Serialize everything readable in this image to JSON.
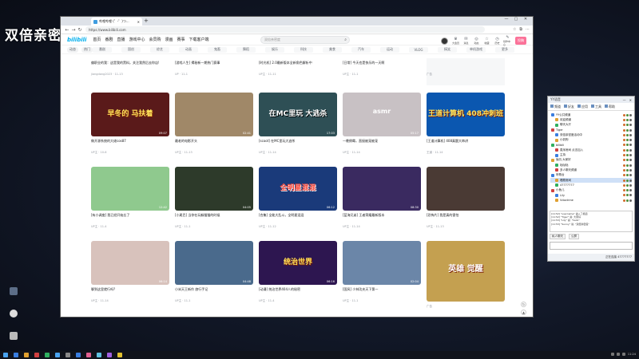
{
  "overlay": {
    "text": "双倍亲密度"
  },
  "browser": {
    "tab_title": "哔哩哔哩 (゜-゜)つ...",
    "url": "https://www.bilibili.com",
    "win_controls": [
      "—",
      "▢",
      "✕"
    ]
  },
  "bili": {
    "logo": "bilibili",
    "nav": [
      "首页",
      "番剧",
      "直播",
      "游戏中心",
      "会员购",
      "漫画",
      "赛事",
      "下载客户端"
    ],
    "search_placeholder": "双倍亲密度",
    "right": [
      "大会员",
      "消息",
      "动态",
      "收藏",
      "历史",
      "创作中心"
    ],
    "upload": "投稿",
    "cat_left": [
      "动态",
      "热门"
    ],
    "categories": [
      "番剧",
      "国创",
      "综艺",
      "动画",
      "鬼畜",
      "舞蹈",
      "娱乐",
      "科技",
      "美食",
      "汽车",
      "运动",
      "VLOG",
      "搞笑",
      "单机游戏",
      "更多"
    ]
  },
  "top_row": [
    {
      "title": "偏职业的我：这是我的黑料，关注我然后去你店!",
      "meta": "jiangdong2023 · 11-13"
    },
    {
      "title": "[游戏人生] 揭秘新一期热门赛事",
      "meta": "UP · 11-1"
    },
    {
      "title": "[时光机] 2.0最新版本全新角色解析中",
      "meta": "UP主 · 11-11"
    },
    {
      "title": "[日常] 今天也是快乐的一天啊",
      "meta": "UP主 · 11-1"
    },
    {
      "title": "",
      "meta": "广告"
    }
  ],
  "rows": [
    [
      {
        "title": "做开源系统的大佬cos87",
        "meta": "UP主 · 10-6",
        "dur": "09:07",
        "stat": "",
        "thumb": "#5a1a1a",
        "tt": "早冬的 马扶着"
      },
      {
        "title": "最老的电影开头",
        "meta": "UP主 · 11-13",
        "dur": "02:41",
        "stat": "",
        "thumb": "#a08868",
        "tt": ""
      },
      {
        "title": "[scoot] 在MC里玩大逃杀",
        "meta": "UP主 · 11-14",
        "dur": "17:03",
        "stat": "",
        "thumb": "#2e4f55",
        "tt": "在MC里玩 大逃杀"
      },
      {
        "title": "一晚倒霉，直接被宠被宠",
        "meta": "UP主 · 11-14",
        "dur": "05:17",
        "stat": "",
        "thumb": "#c8c1c4",
        "tt": "asmr"
      },
      {
        "title": "[王道计算机] 408真题大串讲",
        "meta": "王道 · 11-14",
        "dur": "",
        "stat": "",
        "thumb": "#0b57b0",
        "tt": "王道计算机 408冲刺班"
      }
    ],
    [
      {
        "title": "[有小调度] 我已经开始忘了",
        "meta": "UP主 · 11-4",
        "dur": "12:42",
        "stat": "",
        "thumb": "#8fc98e",
        "tt": ""
      },
      {
        "title": "[小尾巴] 当你在玩躲猫猫的时候",
        "meta": "UP主 · 11-1",
        "dur": "04:05",
        "stat": "",
        "thumb": "#2d3a2a",
        "tt": ""
      },
      {
        "title": "[合集] 全能大乱斗，全明星混混",
        "meta": "UP主 · 11-12",
        "dur": "06:12",
        "stat": "",
        "thumb": "#1a3a7a",
        "tt": "全明星混混"
      },
      {
        "title": "[蓝海兄弟] 王者荣耀最新版本",
        "meta": "UP主 · 11-14",
        "dur": "08:30",
        "stat": "",
        "thumb": "#3a2a60",
        "tt": ""
      },
      {
        "title": "[恐怖片] 我是真的害怕",
        "meta": "UP主 · 11-13",
        "dur": "",
        "stat": "",
        "thumb": "#4a3a34",
        "tt": ""
      }
    ],
    [
      {
        "title": "聊到这里就行吗?",
        "meta": "UP主 · 11-14",
        "dur": "06:14",
        "stat": "",
        "thumb": "#d8c2bc",
        "tt": ""
      },
      {
        "title": "小米天王新作 旅行手记",
        "meta": "UP主 · 11-1",
        "dur": "04:48",
        "stat": "",
        "thumb": "#4a6a8c",
        "tt": ""
      },
      {
        "title": "[动漫] 统治世界404人的秘密",
        "meta": "UP主 · 11-4",
        "dur": "06:16",
        "stat": "",
        "thumb": "#2d1650",
        "tt": "统治世界"
      },
      {
        "title": "[国风] 少林功夫天下第一",
        "meta": "UP主 · 11-1",
        "dur": "02:04",
        "stat": "",
        "thumb": "#6b86a8",
        "tt": ""
      },
      {
        "title": "三国杀 英雄觉醒 全新版本",
        "meta": "广告",
        "dur": "",
        "stat": "",
        "thumb": "#c4a050",
        "tt": "英雄 觉醒"
      }
    ]
  ],
  "side_buttons": [
    "↻",
    "▲",
    "☰"
  ],
  "yy": {
    "title": "YY语音",
    "tools": [
      "频道",
      "好友",
      "应用",
      "工具",
      "帮助"
    ],
    "tree": [
      {
        "label": "YY公共频道",
        "sel": false
      },
      {
        "label": "欢迎频道",
        "sel": false
      },
      {
        "label": "聊天大厅",
        "sel": false
      },
      {
        "label": "Tiger",
        "sel": false
      },
      {
        "label": "双倍亲密度活动中",
        "sel": false
      },
      {
        "label": "小奶狗",
        "sel": false
      },
      {
        "label": "bilibili",
        "sel": false
      },
      {
        "label": "麦序房间 点击加入",
        "sel": false
      },
      {
        "label": "主持",
        "sel": false
      },
      {
        "label": "兔叽 大家好",
        "sel": false
      },
      {
        "label": "哒哒哒",
        "sel": false
      },
      {
        "label": "多人聊天频道",
        "sel": false
      },
      {
        "label": "听歌台",
        "sel": false
      },
      {
        "label": "唱歌房间",
        "sel": true
      },
      {
        "label": "47777777",
        "sel": false
      },
      {
        "label": "小鱼儿",
        "sel": false
      },
      {
        "label": "Lily",
        "sel": false
      },
      {
        "label": "Vdoctrine",
        "sel": false
      },
      {
        "label": "Sunny",
        "sel": false
      },
      {
        "label": "游戏交流",
        "sel": false
      }
    ],
    "log": [
      "[11:52] \"username\" 进入了频道",
      "[11:52] \"Tiger\" 说: 大家好",
      "[11:53] \"Lily\" 说: \"hello\"",
      "[11:53] \"Sunny\" 说: \"双倍亲密度\""
    ],
    "tabs": [
      "私人聊天",
      "公屏"
    ],
    "status": "正在连接 47777777"
  },
  "taskbar": {
    "time": "11:24"
  }
}
